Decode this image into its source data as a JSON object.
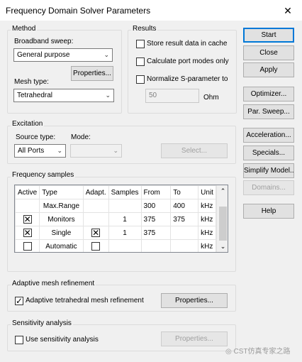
{
  "window": {
    "title": "Frequency Domain Solver Parameters"
  },
  "method": {
    "group_label": "Method",
    "broadband_label": "Broadband sweep:",
    "broadband_value": "General purpose",
    "properties_label": "Properties...",
    "mesh_type_label": "Mesh type:",
    "mesh_type_value": "Tetrahedral"
  },
  "results": {
    "group_label": "Results",
    "store_label": "Store result data in cache",
    "store_checked": false,
    "port_modes_label": "Calculate port modes only",
    "port_modes_checked": false,
    "normalize_label": "Normalize S-parameter to",
    "normalize_checked": false,
    "impedance_value": "50",
    "impedance_unit": "Ohm"
  },
  "excitation": {
    "group_label": "Excitation",
    "source_type_label": "Source type:",
    "source_type_value": "All Ports",
    "mode_label": "Mode:",
    "mode_value": "",
    "select_label": "Select..."
  },
  "frequency_samples": {
    "group_label": "Frequency samples",
    "columns": [
      "Active",
      "Type",
      "Adapt.",
      "Samples",
      "From",
      "To",
      "Unit"
    ],
    "rows": [
      {
        "active": null,
        "type": "Max.Range",
        "adapt": null,
        "samples": "",
        "from": "300",
        "to": "400",
        "unit": "kHz"
      },
      {
        "active": true,
        "type": "Monitors",
        "adapt": null,
        "samples": "1",
        "from": "375",
        "to": "375",
        "unit": "kHz"
      },
      {
        "active": true,
        "type": "Single",
        "adapt": true,
        "samples": "1",
        "from": "375",
        "to": "",
        "unit": "kHz"
      },
      {
        "active": false,
        "type": "Automatic",
        "adapt": false,
        "samples": "",
        "from": "",
        "to": "",
        "unit": "kHz"
      }
    ]
  },
  "adaptive": {
    "group_label": "Adaptive mesh refinement",
    "checkbox_label": "Adaptive tetrahedral mesh refinement",
    "checked": true,
    "properties_label": "Properties..."
  },
  "sensitivity": {
    "group_label": "Sensitivity analysis",
    "checkbox_label": "Use sensitivity analysis",
    "checked": false,
    "properties_label": "Properties..."
  },
  "side_buttons": {
    "start": "Start",
    "close": "Close",
    "apply": "Apply",
    "optimizer": "Optimizer...",
    "par_sweep": "Par. Sweep...",
    "acceleration": "Acceleration...",
    "specials": "Specials...",
    "simplify_model": "Simplify Model...",
    "domains": "Domains...",
    "help": "Help"
  },
  "watermark": "CST仿真专家之路",
  "colors": {
    "accent": "#0078d7",
    "background": "#f0f0f0",
    "disabled_text": "#a0a0a0"
  },
  "icons": {
    "close": "close-icon",
    "dropdown": "chevron-down-icon",
    "check": "checkmark-icon",
    "scroll_up": "scroll-up-icon",
    "scroll_down": "scroll-down-icon"
  }
}
